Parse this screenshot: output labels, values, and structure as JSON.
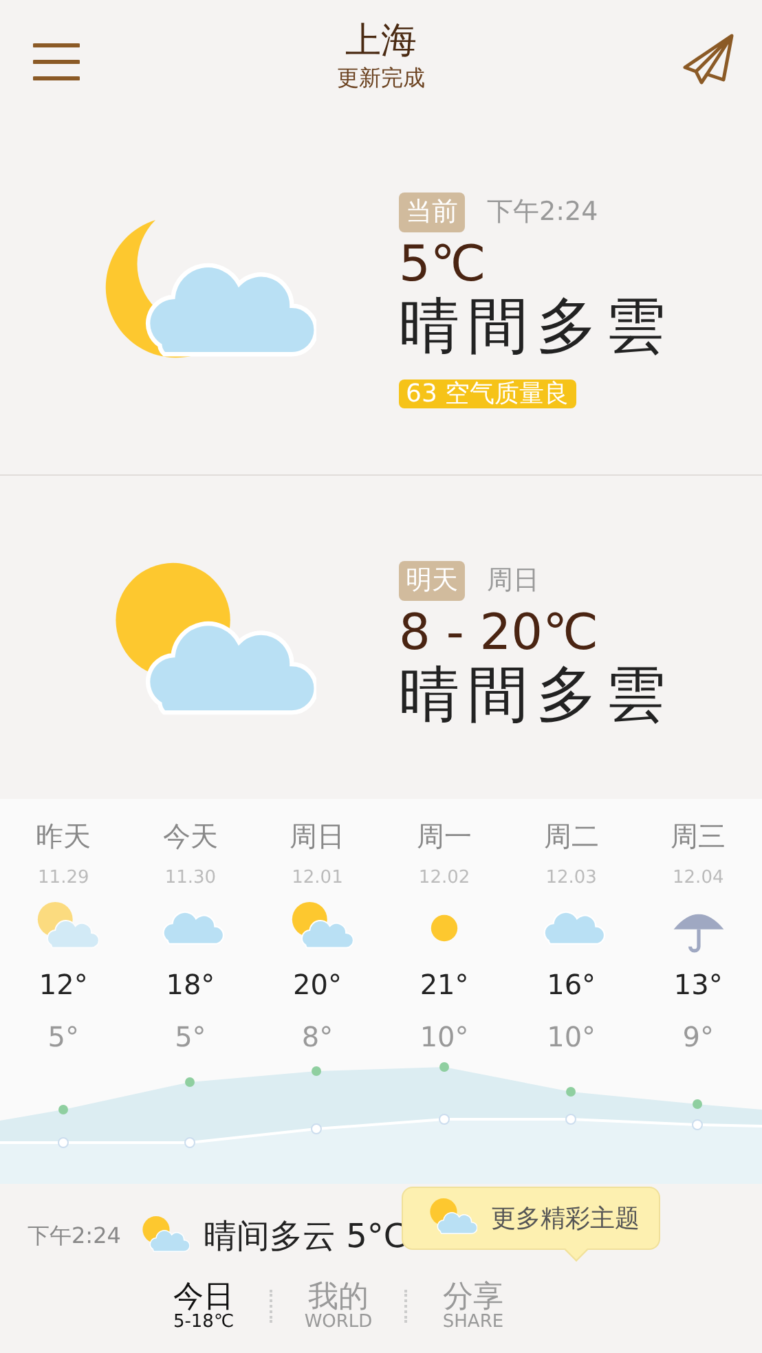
{
  "header": {
    "city": "上海",
    "status": "更新完成"
  },
  "current": {
    "tag": "当前",
    "time": "下午2:24",
    "temp": "5℃",
    "condition": "晴間多雲",
    "aqi": "63 空气质量良",
    "kind": "moon-cloud"
  },
  "tomorrow": {
    "tag": "明天",
    "day": "周日",
    "temp": "8 - 20℃",
    "condition": "晴間多雲",
    "kind": "sun-cloud"
  },
  "forecast": [
    {
      "day": "昨天",
      "date": "11.29",
      "kind": "sun-cloud",
      "high": "12°",
      "low": "5°",
      "past": true
    },
    {
      "day": "今天",
      "date": "11.30",
      "kind": "cloud",
      "high": "18°",
      "low": "5°",
      "past": false
    },
    {
      "day": "周日",
      "date": "12.01",
      "kind": "sun-cloud",
      "high": "20°",
      "low": "8°",
      "past": false
    },
    {
      "day": "周一",
      "date": "12.02",
      "kind": "sun",
      "high": "21°",
      "low": "10°",
      "past": false
    },
    {
      "day": "周二",
      "date": "12.03",
      "kind": "cloud",
      "high": "16°",
      "low": "10°",
      "past": false
    },
    {
      "day": "周三",
      "date": "12.04",
      "kind": "rain",
      "high": "13°",
      "low": "9°",
      "past": false
    }
  ],
  "status_line": {
    "time": "下午2:24",
    "text": "晴间多云 5°C"
  },
  "tooltip": {
    "text": "更多精彩主题"
  },
  "tabs": [
    {
      "label": "今日",
      "sub": "5-18℃",
      "selected": true
    },
    {
      "label": "我的",
      "sub": "WORLD",
      "selected": false
    },
    {
      "label": "分享",
      "sub": "SHARE",
      "selected": false
    }
  ]
}
